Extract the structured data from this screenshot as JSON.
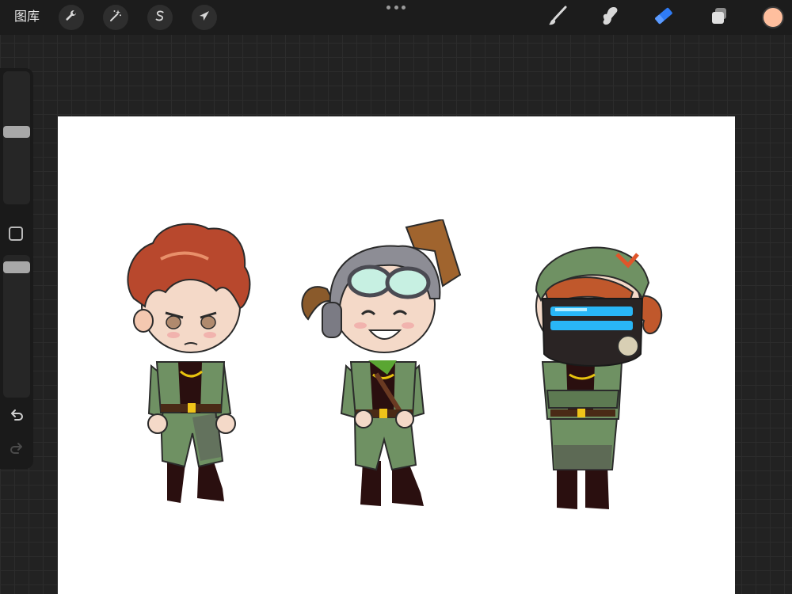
{
  "app": {
    "gallery_label": "图库"
  },
  "toolbar_left": [
    {
      "name": "wrench-icon",
      "action": "actions"
    },
    {
      "name": "magic-wand-icon",
      "action": "adjustments"
    },
    {
      "name": "selection-s-icon",
      "action": "selection"
    },
    {
      "name": "arrow-cursor-icon",
      "action": "transform"
    }
  ],
  "toolbar_right": [
    {
      "name": "brush-icon",
      "action": "paint",
      "active": false
    },
    {
      "name": "smudge-icon",
      "action": "smudge",
      "active": false
    },
    {
      "name": "eraser-icon",
      "action": "erase",
      "active": true
    },
    {
      "name": "layers-icon",
      "action": "layers",
      "active": false
    }
  ],
  "colors": {
    "current_color": "#ffbf9e",
    "active_tool": "#2f7bf5",
    "icon_default": "#d8d8d8",
    "canvas": "#ffffff",
    "jacket_green": "#6f9163",
    "hair_red": "#b8482d"
  },
  "sidebar": {
    "brush_size_level": 0.55,
    "brush_opacity_level": 0.95,
    "undo_icon": "undo-arrow-icon",
    "redo_icon": "redo-arrow-icon",
    "modify_icon": "square-modify-icon"
  },
  "canvas": {
    "characters": [
      "red-hair-character",
      "goggles-character",
      "mask-character"
    ]
  }
}
